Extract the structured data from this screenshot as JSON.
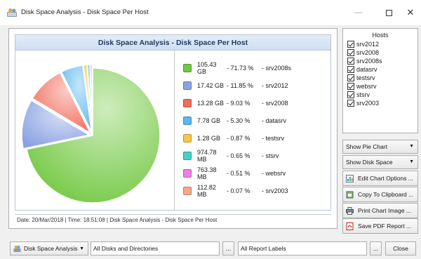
{
  "window": {
    "title": "Disk Space Analysis - Disk Space Per Host",
    "minimize_glyph": "—",
    "close_glyph": "✕"
  },
  "chart_data": {
    "type": "pie",
    "title": "Disk Space Analysis - Disk Space Per Host",
    "categories": [
      "srv2008s",
      "srv2012",
      "srv2008",
      "datasrv",
      "testsrv",
      "stsrv",
      "websrv",
      "srv2003"
    ],
    "values": [
      71.73,
      11.85,
      9.03,
      5.3,
      0.87,
      0.65,
      0.51,
      0.07
    ],
    "sizes": [
      "105.43 GB",
      "17.42 GB",
      "13.28 GB",
      "7.78 GB",
      "1.28 GB",
      "974.78 MB",
      "763.38 MB",
      "112.82 MB"
    ],
    "percent_labels": [
      "71.73 %",
      "11.85 %",
      "9.03 %",
      "5.30 %",
      "0.87 %",
      "0.65 %",
      "0.51 %",
      "0.07 %"
    ],
    "colors": [
      "#72c841",
      "#8aa2e2",
      "#f26c5c",
      "#5ab8f0",
      "#f5c84a",
      "#45d2c4",
      "#f07ee8",
      "#f4a989"
    ],
    "legend_position": "right"
  },
  "legend": [
    {
      "size": "105.43 GB",
      "pct": "- 71.73 %",
      "host": "- srv2008s"
    },
    {
      "size": "17.42 GB",
      "pct": "- 11.85 %",
      "host": "- srv2012"
    },
    {
      "size": "13.28 GB",
      "pct": "- 9.03 %",
      "host": "- srv2008"
    },
    {
      "size": "7.78 GB",
      "pct": "- 5.30 %",
      "host": "- datasrv"
    },
    {
      "size": "1.28 GB",
      "pct": "- 0.87 %",
      "host": "- testsrv"
    },
    {
      "size": "974.78 MB",
      "pct": "- 0.65 %",
      "host": "- stsrv"
    },
    {
      "size": "763.38 MB",
      "pct": "- 0.51 %",
      "host": "- websrv"
    },
    {
      "size": "112.82 MB",
      "pct": "- 0.07 %",
      "host": "- srv2003"
    }
  ],
  "status_line": "Date: 20/Mar/2018 | Time: 18:51:08 | Disk Space Analysis - Disk Space Per Host",
  "hosts": {
    "header": "Hosts",
    "items": [
      "srv2012",
      "srv2008",
      "srv2008s",
      "datasrv",
      "testsrv",
      "websrv",
      "stsrv",
      "srv2003"
    ]
  },
  "side": {
    "chart_type_combo": "Show Pie Chart",
    "metric_combo": "Show Disk Space",
    "edit_options": "Edit Chart Options ...",
    "copy_clipboard": "Copy To Clipboard ...",
    "print_chart": "Print Chart Image ...",
    "save_pdf": "Save PDF Report ..."
  },
  "bottom": {
    "report_type": "Disk Space Analysis",
    "scope_field": "All Disks and Directories",
    "labels_field": "All Report Labels",
    "dots": "...",
    "close": "Close"
  }
}
